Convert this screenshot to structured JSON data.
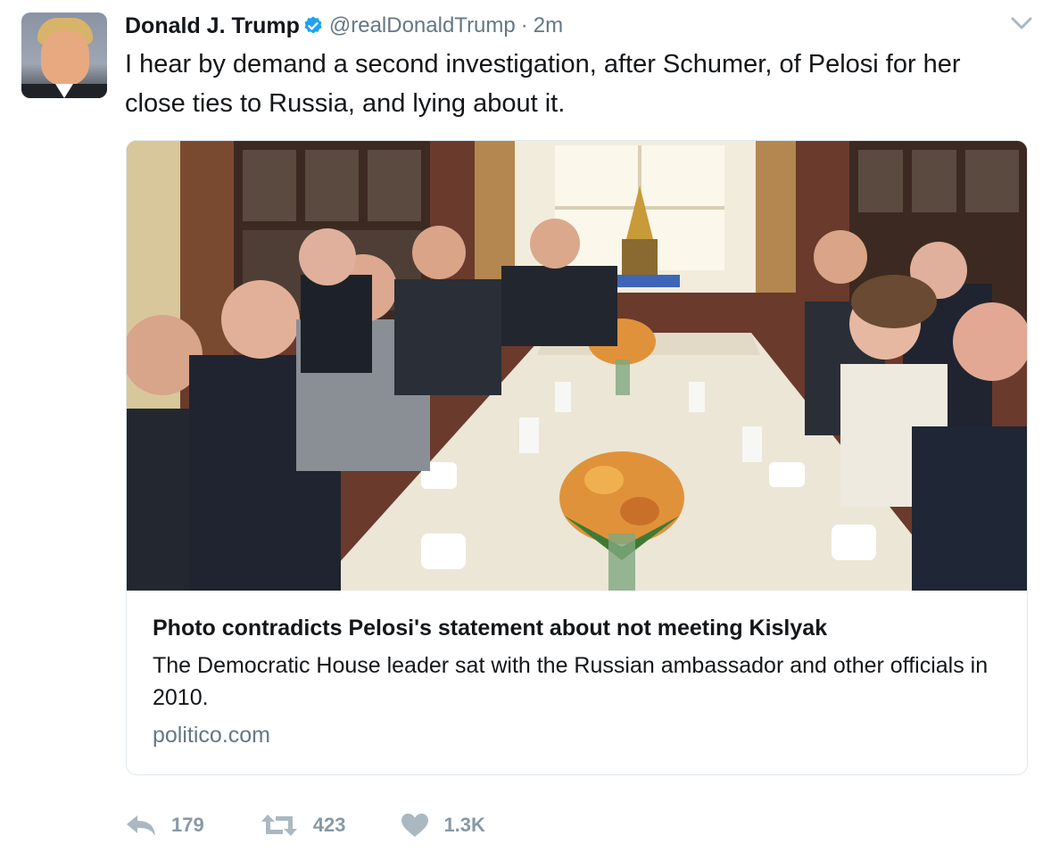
{
  "tweet": {
    "display_name": "Donald J. Trump",
    "handle": "@realDonaldTrump",
    "separator": "·",
    "time": "2m",
    "text": "I hear by demand a second investigation, after Schumer, of Pelosi for her close ties to Russia, and lying about it."
  },
  "card": {
    "title": "Photo contradicts Pelosi's statement about not meeting Kislyak",
    "description": "The Democratic House leader sat with the Russian ambassador and other officials in 2010.",
    "domain": "politico.com"
  },
  "actions": {
    "reply_count": "179",
    "retweet_count": "423",
    "like_count": "1.3K"
  },
  "icons": {
    "verified": "verified-badge-icon",
    "caret": "chevron-down-icon",
    "reply": "reply-icon",
    "retweet": "retweet-icon",
    "like": "heart-icon"
  },
  "colors": {
    "verified_blue": "#1da1f2",
    "text_primary": "#14171a",
    "text_secondary": "#657786",
    "action_gray": "#8899a6"
  }
}
